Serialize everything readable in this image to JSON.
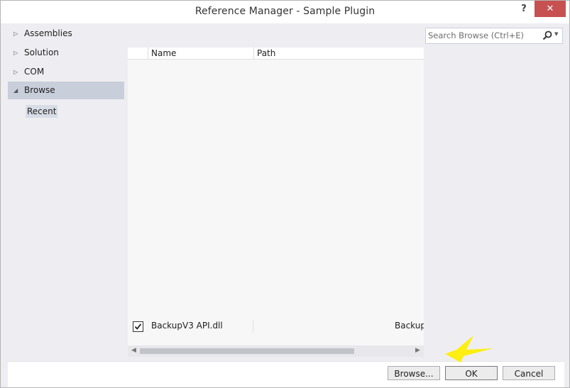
{
  "window": {
    "title": "Reference Manager - Sample Plugin",
    "help": "?",
    "close": "✕"
  },
  "sidebar": {
    "items": [
      {
        "label": "Assemblies",
        "arrow": "▷"
      },
      {
        "label": "Solution",
        "arrow": "▷"
      },
      {
        "label": "COM",
        "arrow": "▷"
      },
      {
        "label": "Browse",
        "arrow": "◢"
      }
    ],
    "sub_items": [
      {
        "label": "Recent"
      }
    ]
  },
  "search": {
    "placeholder": "Search Browse (Ctrl+E)",
    "icon": "magnifier-icon"
  },
  "list": {
    "columns": [
      "Name",
      "Path"
    ],
    "rows": [
      {
        "checked": true,
        "name": "BackupV3 API.dll",
        "path": "BackupV"
      }
    ]
  },
  "buttons": {
    "browse": "Browse...",
    "ok": "OK",
    "cancel": "Cancel"
  },
  "colors": {
    "selected_nav": "#c9cedb",
    "close_button": "#c75050",
    "cursor_highlight": "#ffee00"
  }
}
